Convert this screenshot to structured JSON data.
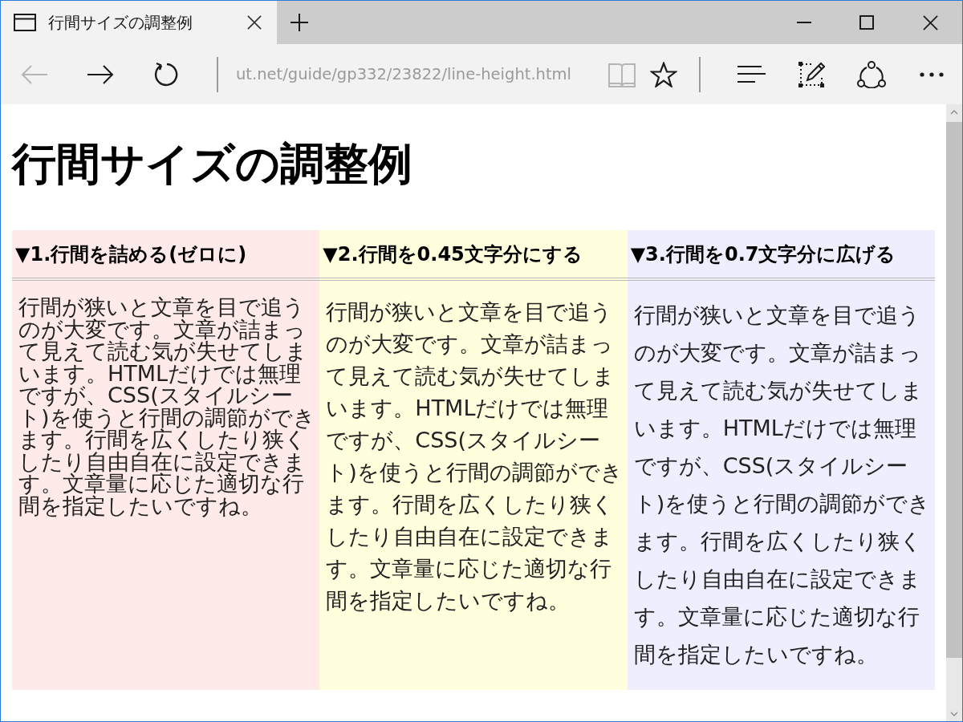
{
  "tabs": [
    {
      "title": "行間サイズの調整例",
      "selected": true
    }
  ],
  "nav_buttons": [
    {
      "kind": "back",
      "disabled": true
    },
    {
      "kind": "forward",
      "disabled": false
    },
    {
      "kind": "refresh",
      "disabled": false
    }
  ],
  "address": "ut.net/guide/gp332/23822/line-height.html",
  "address_buttons": [
    {
      "kind": "reading",
      "disabled": true
    },
    {
      "kind": "favorite",
      "disabled": false
    }
  ],
  "tools": [
    {
      "kind": "hub"
    },
    {
      "kind": "notes"
    },
    {
      "kind": "share"
    },
    {
      "kind": "more"
    }
  ],
  "page": {
    "heading": "行間サイズの調整例",
    "columns": [
      {
        "heading": "▼1.行間を詰める(ゼロに)",
        "kind": "tight",
        "color": "#ffeaea",
        "text": "行間が狭いと文章を目で追うのが大変です。文章が詰まって見えて読む気が失せてしまいます。HTMLだけでは無理ですが、CSS(スタイルシート)を使うと行間の調節ができます。行間を広くしたり狭くしたり自由自在に設定できます。文章量に応じた適切な行間を指定したいですね。"
      },
      {
        "heading": "▼2.行間を0.45文字分にする",
        "kind": "medium",
        "color": "#ffffdd",
        "text": "行間が狭いと文章を目で追うのが大変です。文章が詰まって見えて読む気が失せてしまいます。HTMLだけでは無理ですが、CSS(スタイルシート)を使うと行間の調節ができます。行間を広くしたり狭くしたり自由自在に設定できます。文章量に応じた適切な行間を指定したいですね。"
      },
      {
        "heading": "▼3.行間を0.7文字分に広げる",
        "kind": "wide",
        "color": "#eeeeff",
        "text": "行間が狭いと文章を目で追うのが大変です。文章が詰まって見えて読む気が失せてしまいます。HTMLだけでは無理ですが、CSS(スタイルシート)を使うと行間の調節ができます。行間を広くしたり狭くしたり自由自在に設定できます。文章量に応じた適切な行間を指定したいですね。"
      }
    ]
  }
}
